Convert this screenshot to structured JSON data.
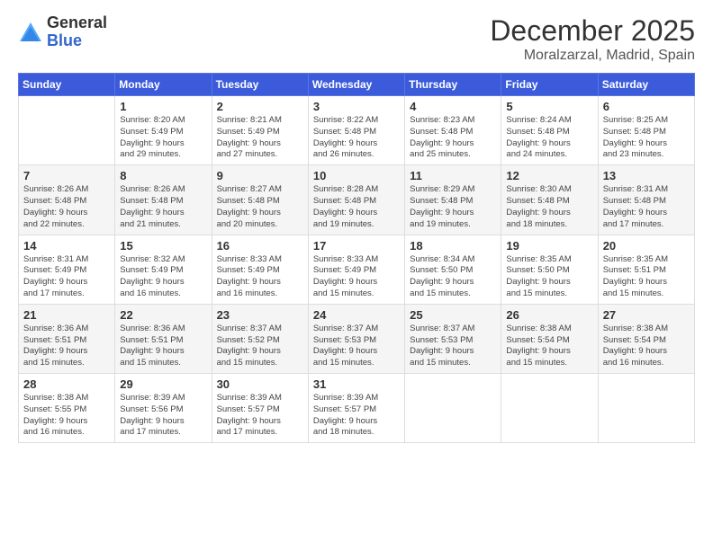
{
  "logo": {
    "general": "General",
    "blue": "Blue"
  },
  "header": {
    "month_year": "December 2025",
    "location": "Moralzarzal, Madrid, Spain"
  },
  "days_of_week": [
    "Sunday",
    "Monday",
    "Tuesday",
    "Wednesday",
    "Thursday",
    "Friday",
    "Saturday"
  ],
  "weeks": [
    [
      {
        "day": "",
        "info": ""
      },
      {
        "day": "1",
        "info": "Sunrise: 8:20 AM\nSunset: 5:49 PM\nDaylight: 9 hours\nand 29 minutes."
      },
      {
        "day": "2",
        "info": "Sunrise: 8:21 AM\nSunset: 5:49 PM\nDaylight: 9 hours\nand 27 minutes."
      },
      {
        "day": "3",
        "info": "Sunrise: 8:22 AM\nSunset: 5:48 PM\nDaylight: 9 hours\nand 26 minutes."
      },
      {
        "day": "4",
        "info": "Sunrise: 8:23 AM\nSunset: 5:48 PM\nDaylight: 9 hours\nand 25 minutes."
      },
      {
        "day": "5",
        "info": "Sunrise: 8:24 AM\nSunset: 5:48 PM\nDaylight: 9 hours\nand 24 minutes."
      },
      {
        "day": "6",
        "info": "Sunrise: 8:25 AM\nSunset: 5:48 PM\nDaylight: 9 hours\nand 23 minutes."
      }
    ],
    [
      {
        "day": "7",
        "info": "Sunrise: 8:26 AM\nSunset: 5:48 PM\nDaylight: 9 hours\nand 22 minutes."
      },
      {
        "day": "8",
        "info": "Sunrise: 8:26 AM\nSunset: 5:48 PM\nDaylight: 9 hours\nand 21 minutes."
      },
      {
        "day": "9",
        "info": "Sunrise: 8:27 AM\nSunset: 5:48 PM\nDaylight: 9 hours\nand 20 minutes."
      },
      {
        "day": "10",
        "info": "Sunrise: 8:28 AM\nSunset: 5:48 PM\nDaylight: 9 hours\nand 19 minutes."
      },
      {
        "day": "11",
        "info": "Sunrise: 8:29 AM\nSunset: 5:48 PM\nDaylight: 9 hours\nand 19 minutes."
      },
      {
        "day": "12",
        "info": "Sunrise: 8:30 AM\nSunset: 5:48 PM\nDaylight: 9 hours\nand 18 minutes."
      },
      {
        "day": "13",
        "info": "Sunrise: 8:31 AM\nSunset: 5:48 PM\nDaylight: 9 hours\nand 17 minutes."
      }
    ],
    [
      {
        "day": "14",
        "info": "Sunrise: 8:31 AM\nSunset: 5:49 PM\nDaylight: 9 hours\nand 17 minutes."
      },
      {
        "day": "15",
        "info": "Sunrise: 8:32 AM\nSunset: 5:49 PM\nDaylight: 9 hours\nand 16 minutes."
      },
      {
        "day": "16",
        "info": "Sunrise: 8:33 AM\nSunset: 5:49 PM\nDaylight: 9 hours\nand 16 minutes."
      },
      {
        "day": "17",
        "info": "Sunrise: 8:33 AM\nSunset: 5:49 PM\nDaylight: 9 hours\nand 15 minutes."
      },
      {
        "day": "18",
        "info": "Sunrise: 8:34 AM\nSunset: 5:50 PM\nDaylight: 9 hours\nand 15 minutes."
      },
      {
        "day": "19",
        "info": "Sunrise: 8:35 AM\nSunset: 5:50 PM\nDaylight: 9 hours\nand 15 minutes."
      },
      {
        "day": "20",
        "info": "Sunrise: 8:35 AM\nSunset: 5:51 PM\nDaylight: 9 hours\nand 15 minutes."
      }
    ],
    [
      {
        "day": "21",
        "info": "Sunrise: 8:36 AM\nSunset: 5:51 PM\nDaylight: 9 hours\nand 15 minutes."
      },
      {
        "day": "22",
        "info": "Sunrise: 8:36 AM\nSunset: 5:51 PM\nDaylight: 9 hours\nand 15 minutes."
      },
      {
        "day": "23",
        "info": "Sunrise: 8:37 AM\nSunset: 5:52 PM\nDaylight: 9 hours\nand 15 minutes."
      },
      {
        "day": "24",
        "info": "Sunrise: 8:37 AM\nSunset: 5:53 PM\nDaylight: 9 hours\nand 15 minutes."
      },
      {
        "day": "25",
        "info": "Sunrise: 8:37 AM\nSunset: 5:53 PM\nDaylight: 9 hours\nand 15 minutes."
      },
      {
        "day": "26",
        "info": "Sunrise: 8:38 AM\nSunset: 5:54 PM\nDaylight: 9 hours\nand 15 minutes."
      },
      {
        "day": "27",
        "info": "Sunrise: 8:38 AM\nSunset: 5:54 PM\nDaylight: 9 hours\nand 16 minutes."
      }
    ],
    [
      {
        "day": "28",
        "info": "Sunrise: 8:38 AM\nSunset: 5:55 PM\nDaylight: 9 hours\nand 16 minutes."
      },
      {
        "day": "29",
        "info": "Sunrise: 8:39 AM\nSunset: 5:56 PM\nDaylight: 9 hours\nand 17 minutes."
      },
      {
        "day": "30",
        "info": "Sunrise: 8:39 AM\nSunset: 5:57 PM\nDaylight: 9 hours\nand 17 minutes."
      },
      {
        "day": "31",
        "info": "Sunrise: 8:39 AM\nSunset: 5:57 PM\nDaylight: 9 hours\nand 18 minutes."
      },
      {
        "day": "",
        "info": ""
      },
      {
        "day": "",
        "info": ""
      },
      {
        "day": "",
        "info": ""
      }
    ]
  ]
}
